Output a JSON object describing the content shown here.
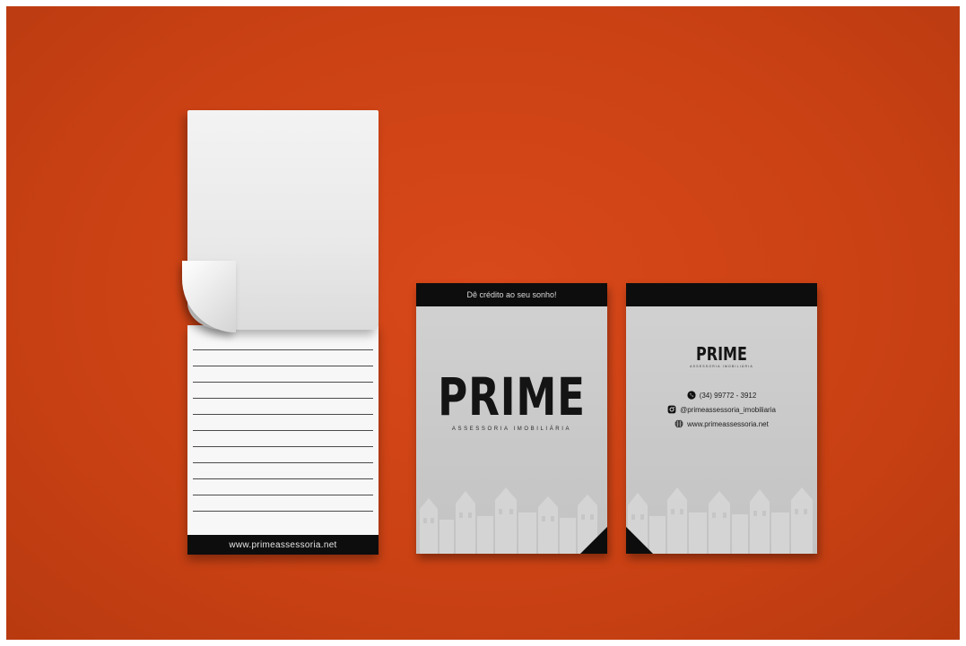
{
  "notepad": {
    "footer_url": "www.primeassessoria.net"
  },
  "card_front": {
    "tagline": "Dê crédito ao seu sonho!",
    "brand": "PRIME",
    "brand_subtitle": "ASSESSORIA IMOBILIÁRIA"
  },
  "card_back": {
    "brand": "PRIME",
    "brand_subtitle": "ASSESSORIA IMOBILIÁRIA",
    "phone": "(34) 99772 - 3912",
    "instagram": "@primeassessoria_imobiliaria",
    "website": "www.primeassessoria.net",
    "icons": [
      "whatsapp-icon",
      "instagram-icon",
      "globe-icon"
    ]
  },
  "colors": {
    "background": "#cb4214",
    "card_gray": "#c9c9c9",
    "black": "#0d0d0d"
  }
}
